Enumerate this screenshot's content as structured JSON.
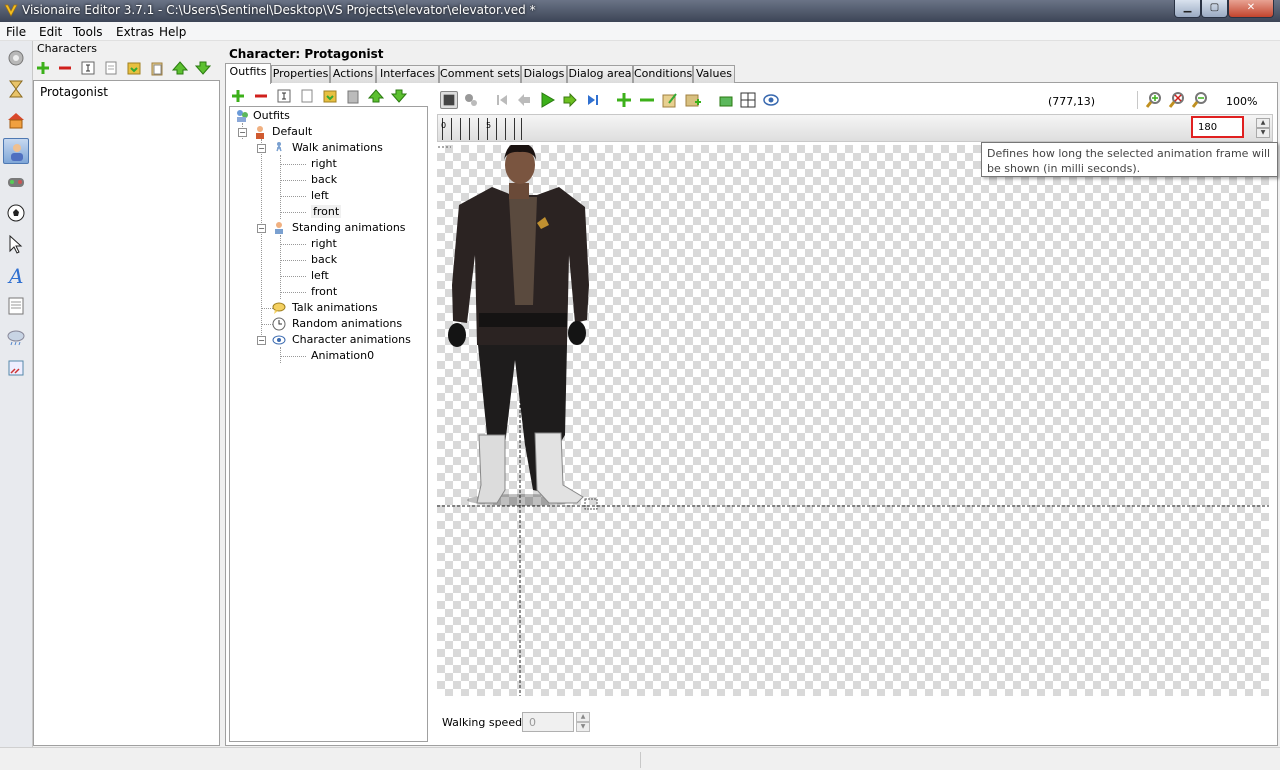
{
  "window": {
    "title": "Visionaire Editor 3.7.1 - C:\\Users\\Sentinel\\Desktop\\VS Projects\\elevator\\elevator.ved *"
  },
  "menu": [
    "File",
    "Edit",
    "Tools",
    "Extras",
    "Help"
  ],
  "left_toolbar": [
    {
      "name": "game-settings-icon"
    },
    {
      "name": "hourglass-icon"
    },
    {
      "name": "scenes-icon"
    },
    {
      "name": "characters-icon",
      "active": true
    },
    {
      "name": "interfaces-icon"
    },
    {
      "name": "objects-icon"
    },
    {
      "name": "mouse-cursor-icon"
    },
    {
      "name": "fonts-icon"
    },
    {
      "name": "texts-icon"
    },
    {
      "name": "particles-icon"
    },
    {
      "name": "scripts-icon"
    }
  ],
  "characters_panel": {
    "label": "Characters",
    "items": [
      "Protagonist"
    ]
  },
  "main": {
    "heading": "Character: Protagonist",
    "tabs": [
      "Outfits",
      "Properties",
      "Actions",
      "Interfaces",
      "Comment sets",
      "Dialogs",
      "Dialog area",
      "Conditions",
      "Values"
    ],
    "active_tab": "Outfits"
  },
  "tree": {
    "root": "Outfits",
    "outfit": "Default",
    "walk": {
      "label": "Walk animations",
      "items": [
        "right",
        "back",
        "left",
        "front"
      ]
    },
    "standing": {
      "label": "Standing animations",
      "items": [
        "right",
        "back",
        "left",
        "front"
      ]
    },
    "talk": "Talk animations",
    "random": "Random animations",
    "character": {
      "label": "Character animations",
      "items": [
        "Animation0"
      ]
    }
  },
  "editor": {
    "coords": "(777,13)",
    "zoom": "100%",
    "frame_marks": [
      "0",
      "5"
    ],
    "frame_time": "180",
    "tooltip": "Defines how long the selected animation frame will be shown (in milli seconds).",
    "walking_speed_label": "Walking speed",
    "walking_speed_value": "0"
  },
  "colors": {
    "accent_red": "#e02020",
    "green": "#3cb01a",
    "red": "#d0201c"
  }
}
